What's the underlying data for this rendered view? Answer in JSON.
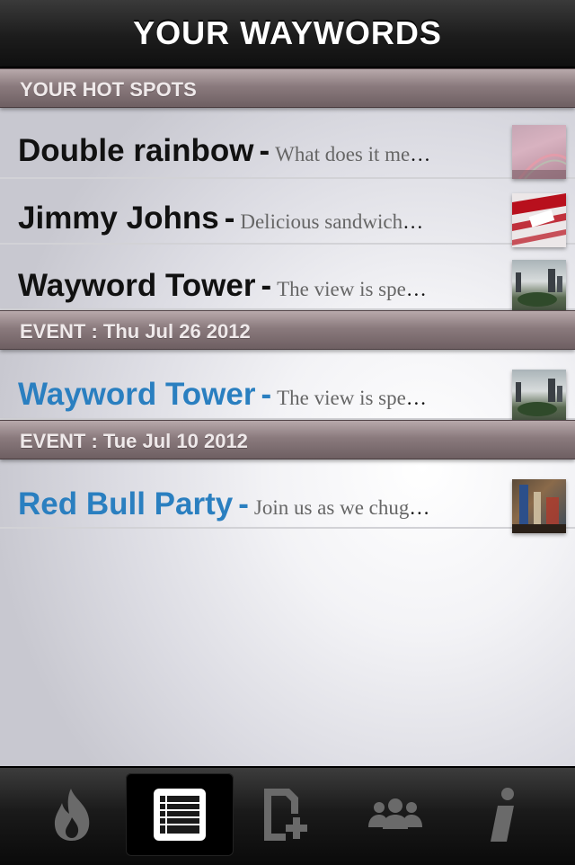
{
  "header": {
    "title": "YOUR WAYWORDS"
  },
  "sections": [
    {
      "header": "YOUR HOT SPOTS",
      "rows": [
        {
          "name": "Double rainbow",
          "desc": "What does it me",
          "icon": "double-rainbow-photo"
        },
        {
          "name": "Jimmy Johns",
          "desc": "Delicious sandwich",
          "icon": "sandwich-wrapper-photo"
        },
        {
          "name": "Wayword Tower",
          "desc": "The view is spe",
          "icon": "city-skyline-photo"
        }
      ]
    },
    {
      "header": "EVENT : Thu Jul 26 2012",
      "rows": [
        {
          "name": "Wayword Tower",
          "desc": "The view is spe",
          "icon": "city-skyline-photo"
        }
      ]
    },
    {
      "header": "EVENT : Tue Jul 10 2012",
      "rows": [
        {
          "name": "Red Bull Party",
          "desc": "Join us as we chug",
          "icon": "party-photo"
        }
      ]
    }
  ],
  "separator": "-",
  "ellipsis": "…",
  "tabbar": {
    "tabs": [
      {
        "icon": "flame-icon",
        "active": false
      },
      {
        "icon": "list-icon",
        "active": true
      },
      {
        "icon": "add-document-icon",
        "active": false
      },
      {
        "icon": "people-icon",
        "active": false
      },
      {
        "icon": "info-icon",
        "active": false
      }
    ]
  },
  "colors": {
    "event_title": "#2a7fc0",
    "section_header": "#8a7a7d",
    "navbar": "#1c1c1c"
  }
}
